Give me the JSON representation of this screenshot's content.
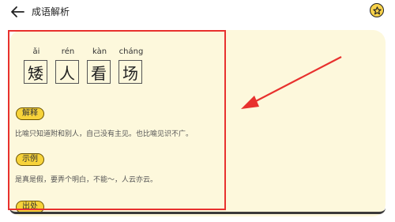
{
  "header": {
    "title": "成语解析",
    "back_icon": "back-arrow-icon",
    "star_icon": "star-icon"
  },
  "idiom": {
    "pinyin": [
      "ǎi",
      "rén",
      "kàn",
      "cháng"
    ],
    "chars": [
      "矮",
      "人",
      "看",
      "场"
    ]
  },
  "sections": {
    "explanation": {
      "label": "解释",
      "text": "比喻只知道附和别人，自己没有主见。也比喻见识不广。"
    },
    "example": {
      "label": "示例",
      "text": "是真是假，要弄个明白，不能～，人云亦云。"
    },
    "source": {
      "label": "出处"
    }
  },
  "colors": {
    "accent": "#f7d33a",
    "card_bg": "#fdf8dc",
    "annotation": "#e8312e"
  }
}
